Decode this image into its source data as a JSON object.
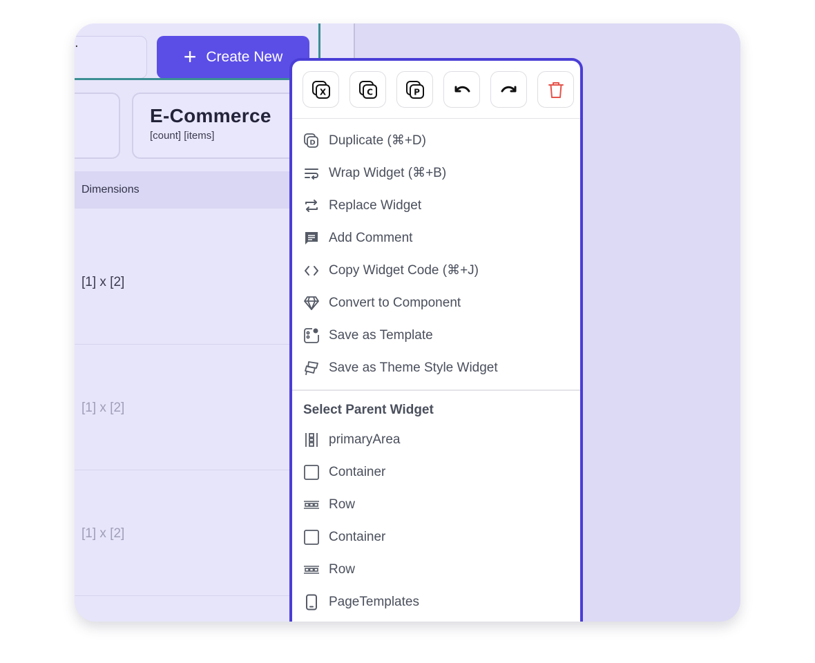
{
  "toolbar_left": {
    "input_text": ".",
    "create_button": {
      "icon": "plus-icon",
      "label": "Create New"
    }
  },
  "category_card": {
    "title": "E-Commerce",
    "subtitle": "[count] [items]"
  },
  "table": {
    "header": "Dimensions",
    "rows": [
      "[1] x [2]",
      "[1] x [2]",
      "[1] x [2]"
    ]
  },
  "context_menu": {
    "toolbar": [
      {
        "icon": "cut-icon",
        "glyph": "X"
      },
      {
        "icon": "copy-icon",
        "glyph": "C"
      },
      {
        "icon": "paste-icon",
        "glyph": "P"
      },
      {
        "icon": "undo-icon"
      },
      {
        "icon": "redo-icon"
      },
      {
        "icon": "trash-icon",
        "color": "#e5534b"
      }
    ],
    "items": [
      {
        "icon": "duplicate-icon",
        "label": "Duplicate (⌘+D)"
      },
      {
        "icon": "wrap-icon",
        "label": "Wrap Widget (⌘+B)"
      },
      {
        "icon": "replace-icon",
        "label": "Replace Widget"
      },
      {
        "icon": "comment-icon",
        "label": "Add Comment"
      },
      {
        "icon": "code-icon",
        "label": "Copy Widget Code (⌘+J)"
      },
      {
        "icon": "diamond-icon",
        "label": "Convert to Component"
      },
      {
        "icon": "template-icon",
        "label": "Save as Template"
      },
      {
        "icon": "theme-style-icon",
        "label": "Save as Theme Style Widget"
      }
    ],
    "parent_section_title": "Select Parent Widget",
    "parents": [
      {
        "icon": "column-icon",
        "label": "primaryArea"
      },
      {
        "icon": "container-icon",
        "label": "Container"
      },
      {
        "icon": "row-icon",
        "label": "Row"
      },
      {
        "icon": "container-icon",
        "label": "Container"
      },
      {
        "icon": "row-icon",
        "label": "Row"
      },
      {
        "icon": "phone-icon",
        "label": "PageTemplates"
      }
    ]
  },
  "colors": {
    "accent": "#5b4ee7",
    "menu_border": "#4a3ed6",
    "danger": "#e5534b",
    "background": "#dcdaf5"
  }
}
